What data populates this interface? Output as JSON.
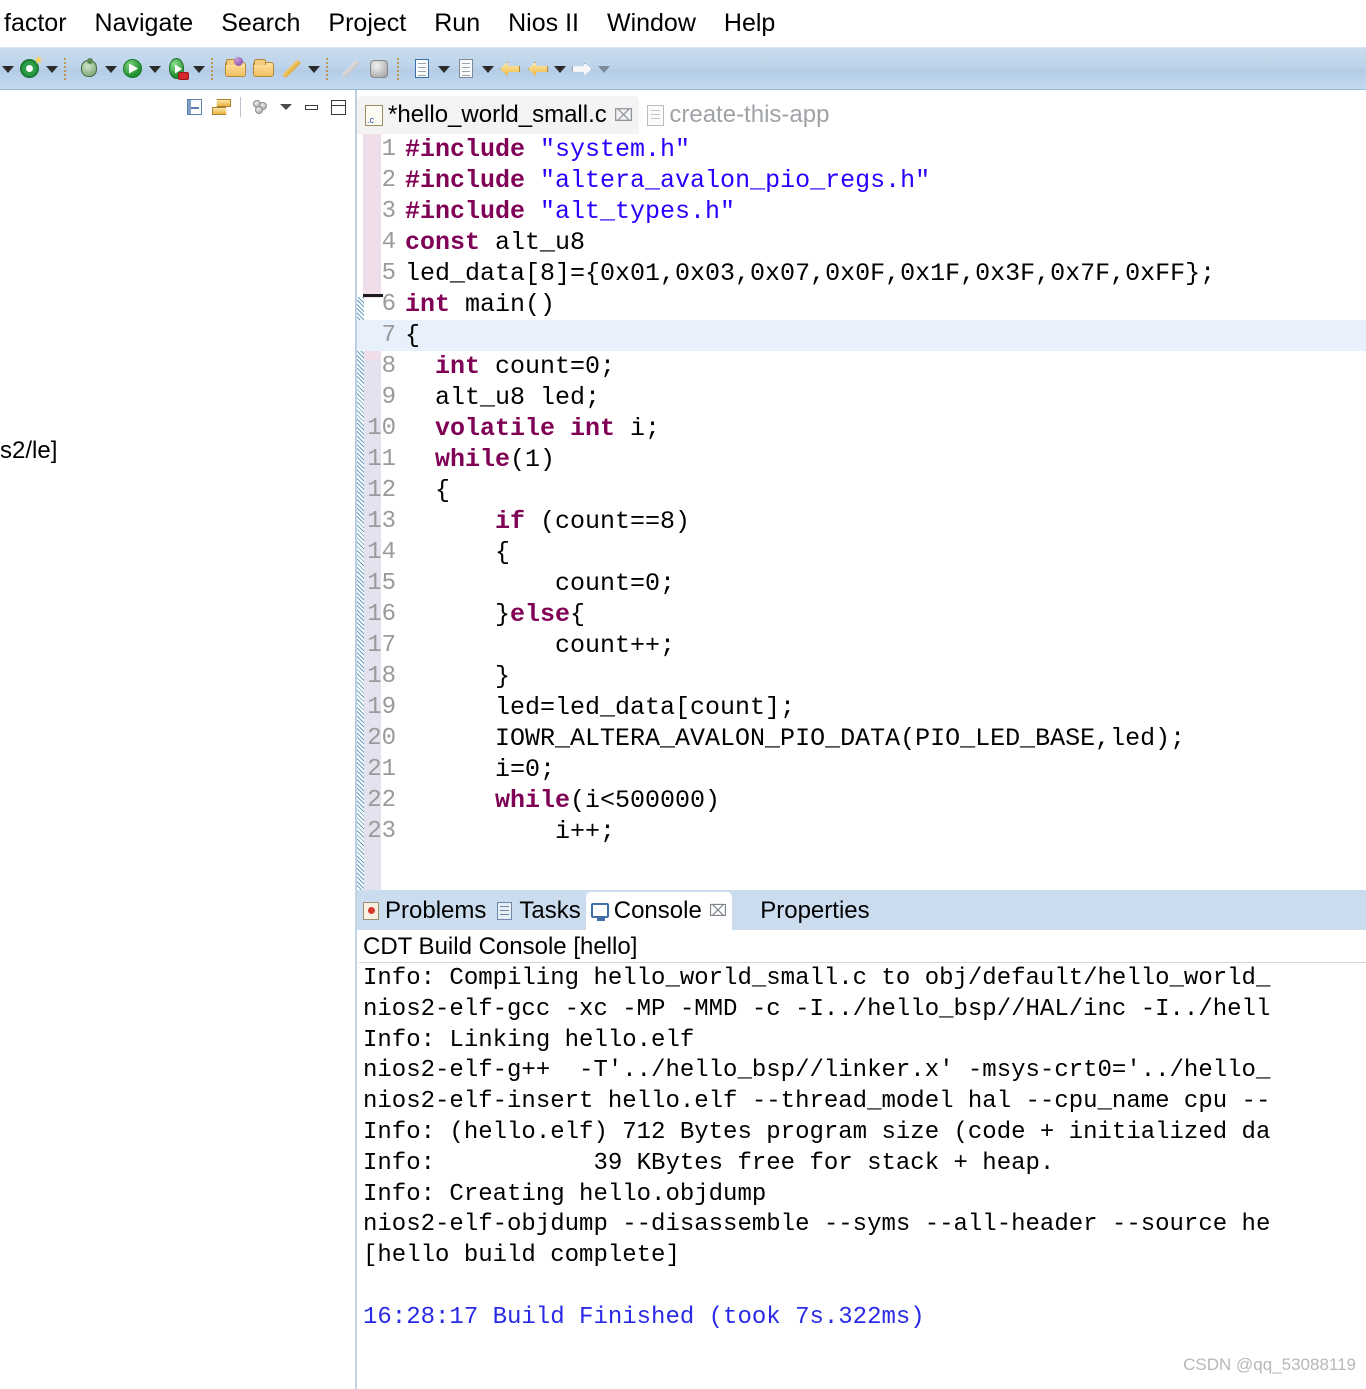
{
  "menubar": {
    "items": [
      {
        "label": "factor"
      },
      {
        "label": "Navigate"
      },
      {
        "label": "Search"
      },
      {
        "label": "Project"
      },
      {
        "label": "Run"
      },
      {
        "label": "Nios II"
      },
      {
        "label": "Window"
      },
      {
        "label": "Help"
      }
    ]
  },
  "toolbar": {
    "icons": [
      {
        "name": "caret-dropdown-0",
        "kind": "caret"
      },
      {
        "name": "new-c-project-icon",
        "kind": "green-c-star"
      },
      {
        "name": "caret-dropdown-1",
        "kind": "caret"
      },
      {
        "name": "separator-1",
        "kind": "sep"
      },
      {
        "name": "debug-bug-icon",
        "kind": "bug"
      },
      {
        "name": "caret-dropdown-2",
        "kind": "caret"
      },
      {
        "name": "run-icon",
        "kind": "run-green"
      },
      {
        "name": "caret-dropdown-3",
        "kind": "caret"
      },
      {
        "name": "run-external-tools-icon",
        "kind": "run-red"
      },
      {
        "name": "caret-dropdown-4",
        "kind": "caret"
      },
      {
        "name": "separator-2",
        "kind": "sep"
      },
      {
        "name": "open-folder-purple-icon",
        "kind": "folder-purple"
      },
      {
        "name": "open-folder-icon",
        "kind": "folder"
      },
      {
        "name": "pencil-edit-icon",
        "kind": "pencil"
      },
      {
        "name": "caret-dropdown-5",
        "kind": "caret"
      },
      {
        "name": "separator-3",
        "kind": "sep"
      },
      {
        "name": "brush-icon",
        "kind": "brush"
      },
      {
        "name": "gray-blob-icon",
        "kind": "blob"
      },
      {
        "name": "separator-4",
        "kind": "sep"
      },
      {
        "name": "document-blue-icon",
        "kind": "doc-blue"
      },
      {
        "name": "caret-dropdown-6",
        "kind": "caret"
      },
      {
        "name": "document-icon",
        "kind": "doc"
      },
      {
        "name": "caret-dropdown-7",
        "kind": "caret"
      },
      {
        "name": "back-arrow-icon",
        "kind": "arrow-left"
      },
      {
        "name": "forward-arrow-icon",
        "kind": "arrow-left2"
      },
      {
        "name": "caret-dropdown-8",
        "kind": "caret"
      },
      {
        "name": "next-arrow-icon",
        "kind": "arrow-right-white"
      },
      {
        "name": "caret-dropdown-9",
        "kind": "caret-light"
      }
    ]
  },
  "left_panel": {
    "toolbar": [
      {
        "name": "collapse-all-icon"
      },
      {
        "name": "link-with-editor-icon"
      },
      {
        "name": "view-menu-blobs-icon"
      },
      {
        "name": "view-menu-icon"
      },
      {
        "name": "minimize-icon"
      },
      {
        "name": "maximize-icon"
      }
    ],
    "visible_text": "s2/le]"
  },
  "editor": {
    "tabs": [
      {
        "label": "*hello_world_small.c",
        "active": true,
        "icon": "c-file-icon",
        "close": "⌧"
      },
      {
        "label": "create-this-app",
        "active": false,
        "icon": "document-icon",
        "close": ""
      }
    ],
    "highlighted_line": 7,
    "lines": [
      {
        "n": 1,
        "tokens": [
          {
            "t": "#include ",
            "c": "pp"
          },
          {
            "t": "\"system.h\"",
            "c": "str"
          }
        ]
      },
      {
        "n": 2,
        "tokens": [
          {
            "t": "#include ",
            "c": "pp"
          },
          {
            "t": "\"altera_avalon_pio_regs.h\"",
            "c": "str"
          }
        ]
      },
      {
        "n": 3,
        "tokens": [
          {
            "t": "#include ",
            "c": "pp"
          },
          {
            "t": "\"alt_types.h\"",
            "c": "str"
          }
        ]
      },
      {
        "n": 4,
        "tokens": [
          {
            "t": "const",
            "c": "kw"
          },
          {
            "t": " alt_u8",
            "c": "plain"
          }
        ]
      },
      {
        "n": 5,
        "tokens": [
          {
            "t": "led_data[8]={0x01,0x03,0x07,0x0F,0x1F,0x3F,0x7F,0xFF};",
            "c": "plain"
          }
        ]
      },
      {
        "n": 6,
        "tokens": [
          {
            "t": "int",
            "c": "kw"
          },
          {
            "t": " ",
            "c": "plain"
          },
          {
            "t": "main",
            "c": "plain"
          },
          {
            "t": "()",
            "c": "plain"
          }
        ]
      },
      {
        "n": 7,
        "tokens": [
          {
            "t": "{",
            "c": "plain"
          }
        ]
      },
      {
        "n": 8,
        "tokens": [
          {
            "t": "  ",
            "c": "plain"
          },
          {
            "t": "int",
            "c": "kw"
          },
          {
            "t": " count=0;",
            "c": "plain"
          }
        ]
      },
      {
        "n": 9,
        "tokens": [
          {
            "t": "  alt_u8 led;",
            "c": "plain"
          }
        ]
      },
      {
        "n": 10,
        "tokens": [
          {
            "t": "  ",
            "c": "plain"
          },
          {
            "t": "volatile int",
            "c": "kw"
          },
          {
            "t": " i;",
            "c": "plain"
          }
        ]
      },
      {
        "n": 11,
        "tokens": [
          {
            "t": "  ",
            "c": "plain"
          },
          {
            "t": "while",
            "c": "kw"
          },
          {
            "t": "(1)",
            "c": "plain"
          }
        ]
      },
      {
        "n": 12,
        "tokens": [
          {
            "t": "  {",
            "c": "plain"
          }
        ]
      },
      {
        "n": 13,
        "tokens": [
          {
            "t": "      ",
            "c": "plain"
          },
          {
            "t": "if",
            "c": "kw"
          },
          {
            "t": " (count==8)",
            "c": "plain"
          }
        ]
      },
      {
        "n": 14,
        "tokens": [
          {
            "t": "      {",
            "c": "plain"
          }
        ]
      },
      {
        "n": 15,
        "tokens": [
          {
            "t": "          count=0;",
            "c": "plain"
          }
        ]
      },
      {
        "n": 16,
        "tokens": [
          {
            "t": "      }",
            "c": "plain"
          },
          {
            "t": "else",
            "c": "kw"
          },
          {
            "t": "{",
            "c": "plain"
          }
        ]
      },
      {
        "n": 17,
        "tokens": [
          {
            "t": "          count++;",
            "c": "plain"
          }
        ]
      },
      {
        "n": 18,
        "tokens": [
          {
            "t": "      }",
            "c": "plain"
          }
        ]
      },
      {
        "n": 19,
        "tokens": [
          {
            "t": "      led=led_data[count];",
            "c": "plain"
          }
        ]
      },
      {
        "n": 20,
        "tokens": [
          {
            "t": "      IOWR_ALTERA_AVALON_PIO_DATA(PIO_LED_BASE,led);",
            "c": "plain"
          }
        ]
      },
      {
        "n": 21,
        "tokens": [
          {
            "t": "      i=0;",
            "c": "plain"
          }
        ]
      },
      {
        "n": 22,
        "tokens": [
          {
            "t": "      ",
            "c": "plain"
          },
          {
            "t": "while",
            "c": "kw"
          },
          {
            "t": "(i<500000)",
            "c": "plain"
          }
        ]
      },
      {
        "n": 23,
        "tokens": [
          {
            "t": "          i++;",
            "c": "plain"
          }
        ]
      }
    ]
  },
  "bottom_panel": {
    "tabs": [
      {
        "label": "Problems",
        "icon": "problems-icon",
        "active": false
      },
      {
        "label": "Tasks",
        "icon": "tasks-icon",
        "active": false
      },
      {
        "label": "Console",
        "icon": "console-icon",
        "active": true,
        "close": "⌧"
      },
      {
        "label": "Properties",
        "icon": "properties-icon",
        "active": false
      }
    ],
    "console_title": "CDT Build Console [hello]",
    "console_lines": [
      {
        "text": "Info: Compiling hello_world_small.c to obj/default/hello_world_",
        "color": "black"
      },
      {
        "text": "nios2-elf-gcc -xc -MP -MMD -c -I../hello_bsp//HAL/inc -I../hell",
        "color": "black"
      },
      {
        "text": "Info: Linking hello.elf",
        "color": "black"
      },
      {
        "text": "nios2-elf-g++  -T'../hello_bsp//linker.x' -msys-crt0='../hello_",
        "color": "black"
      },
      {
        "text": "nios2-elf-insert hello.elf --thread_model hal --cpu_name cpu --",
        "color": "black"
      },
      {
        "text": "Info: (hello.elf) 712 Bytes program size (code + initialized da",
        "color": "black"
      },
      {
        "text": "Info:           39 KBytes free for stack + heap.",
        "color": "black"
      },
      {
        "text": "Info: Creating hello.objdump",
        "color": "black"
      },
      {
        "text": "nios2-elf-objdump --disassemble --syms --all-header --source he",
        "color": "black"
      },
      {
        "text": "[hello build complete]",
        "color": "black"
      },
      {
        "text": " ",
        "color": "black"
      },
      {
        "text": "16:28:17 Build Finished (took 7s.322ms)",
        "color": "blue"
      }
    ]
  },
  "watermark": "CSDN @qq_53088119",
  "colors": {
    "toolbar_bg": "#bdd4ea",
    "tab_bar_bg": "#cbdcee",
    "keyword": "#7f0055",
    "string": "#2a00ff",
    "line_number": "#9a9a9a",
    "highlight_line": "#e8f0fb",
    "console_blue": "#2a2ae6",
    "change_bar": "#f0ddea"
  }
}
